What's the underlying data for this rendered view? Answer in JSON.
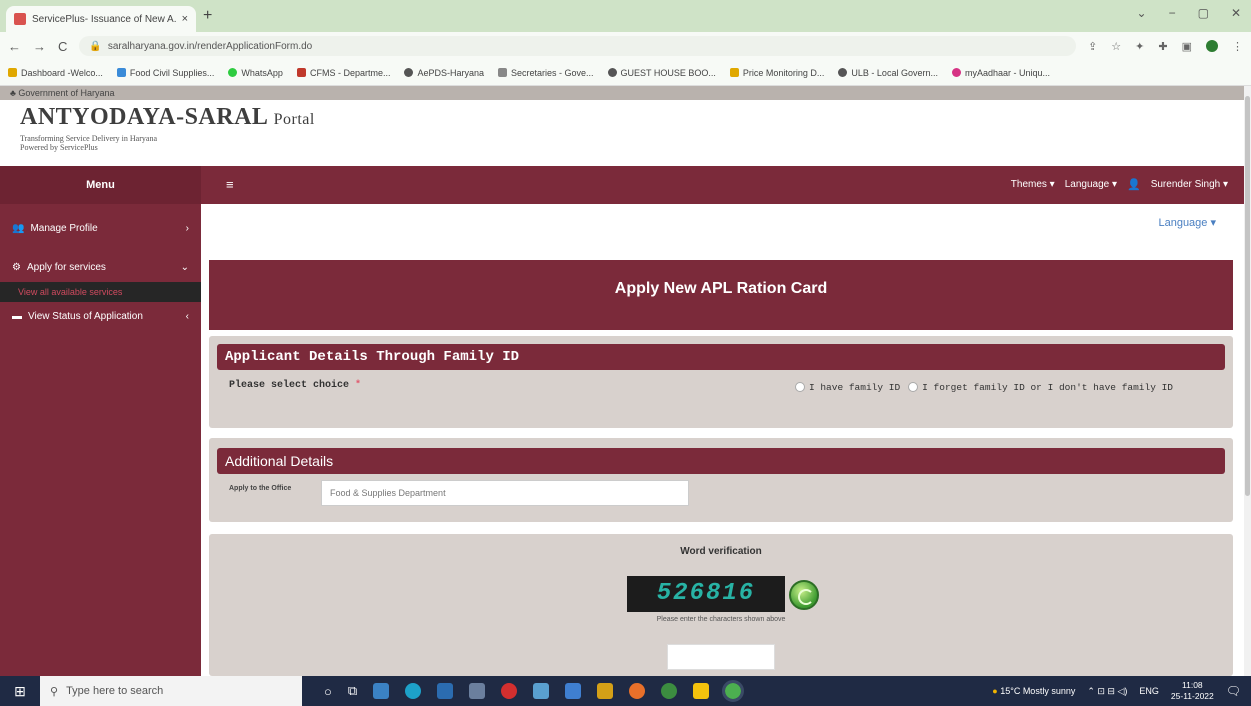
{
  "browser": {
    "tab_title": "ServicePlus- Issuance of New A...",
    "tab_close": "×",
    "new_tab": "+",
    "url": "saralharyana.gov.in/renderApplicationForm.do",
    "window_controls": [
      "⌄",
      "−",
      "▢",
      "✕"
    ],
    "bookmarks": [
      "Dashboard -Welco...",
      "Food Civil Supplies...",
      "WhatsApp",
      "CFMS - Departme...",
      "AePDS-Haryana",
      "Secretaries - Gove...",
      "GUEST HOUSE BOO...",
      "Price Monitoring D...",
      "ULB - Local Govern...",
      "myAadhaar - Uniqu..."
    ]
  },
  "header": {
    "gov_strip": "Government of Haryana",
    "title_main": "ANTYODAYA-SARAL",
    "title_portal": "Portal",
    "subtitle": "Transforming Service Delivery in Haryana",
    "powered_by": "Powered by ServicePlus"
  },
  "topnav": {
    "menu_label": "Menu",
    "burger": "≡",
    "themes": "Themes ▾",
    "language": "Language ▾",
    "user": "Surender Singh ▾"
  },
  "sidebar": {
    "items": [
      {
        "icon": "👥",
        "label": "Manage Profile",
        "chevron": "›"
      },
      {
        "icon": "⚙",
        "label": "Apply for services",
        "chevron": "⌄"
      },
      {
        "label": "View all available services"
      },
      {
        "icon": "▬",
        "label": "View Status of Application",
        "chevron": "‹"
      }
    ]
  },
  "main": {
    "language_link": "Language ▾",
    "banner_title": "Apply New APL Ration Card",
    "applicant_section": {
      "heading": "Applicant Details Through Family ID",
      "choice_label": "Please select choice",
      "required_mark": "*",
      "options": [
        "I have family ID",
        "I forget family ID or I don't have family ID"
      ]
    },
    "additional_section": {
      "heading": "Additional Details",
      "office_label": "Apply to the Office",
      "office_value": "Food & Supplies Department"
    },
    "verification": {
      "title": "Word verification",
      "captcha_text": "526816",
      "hint": "Please enter the characters shown above"
    }
  },
  "taskbar": {
    "search_placeholder": "Type here to search",
    "weather": "15°C  Mostly sunny",
    "language": "ENG",
    "time": "11:08",
    "date": "25-11-2022"
  }
}
